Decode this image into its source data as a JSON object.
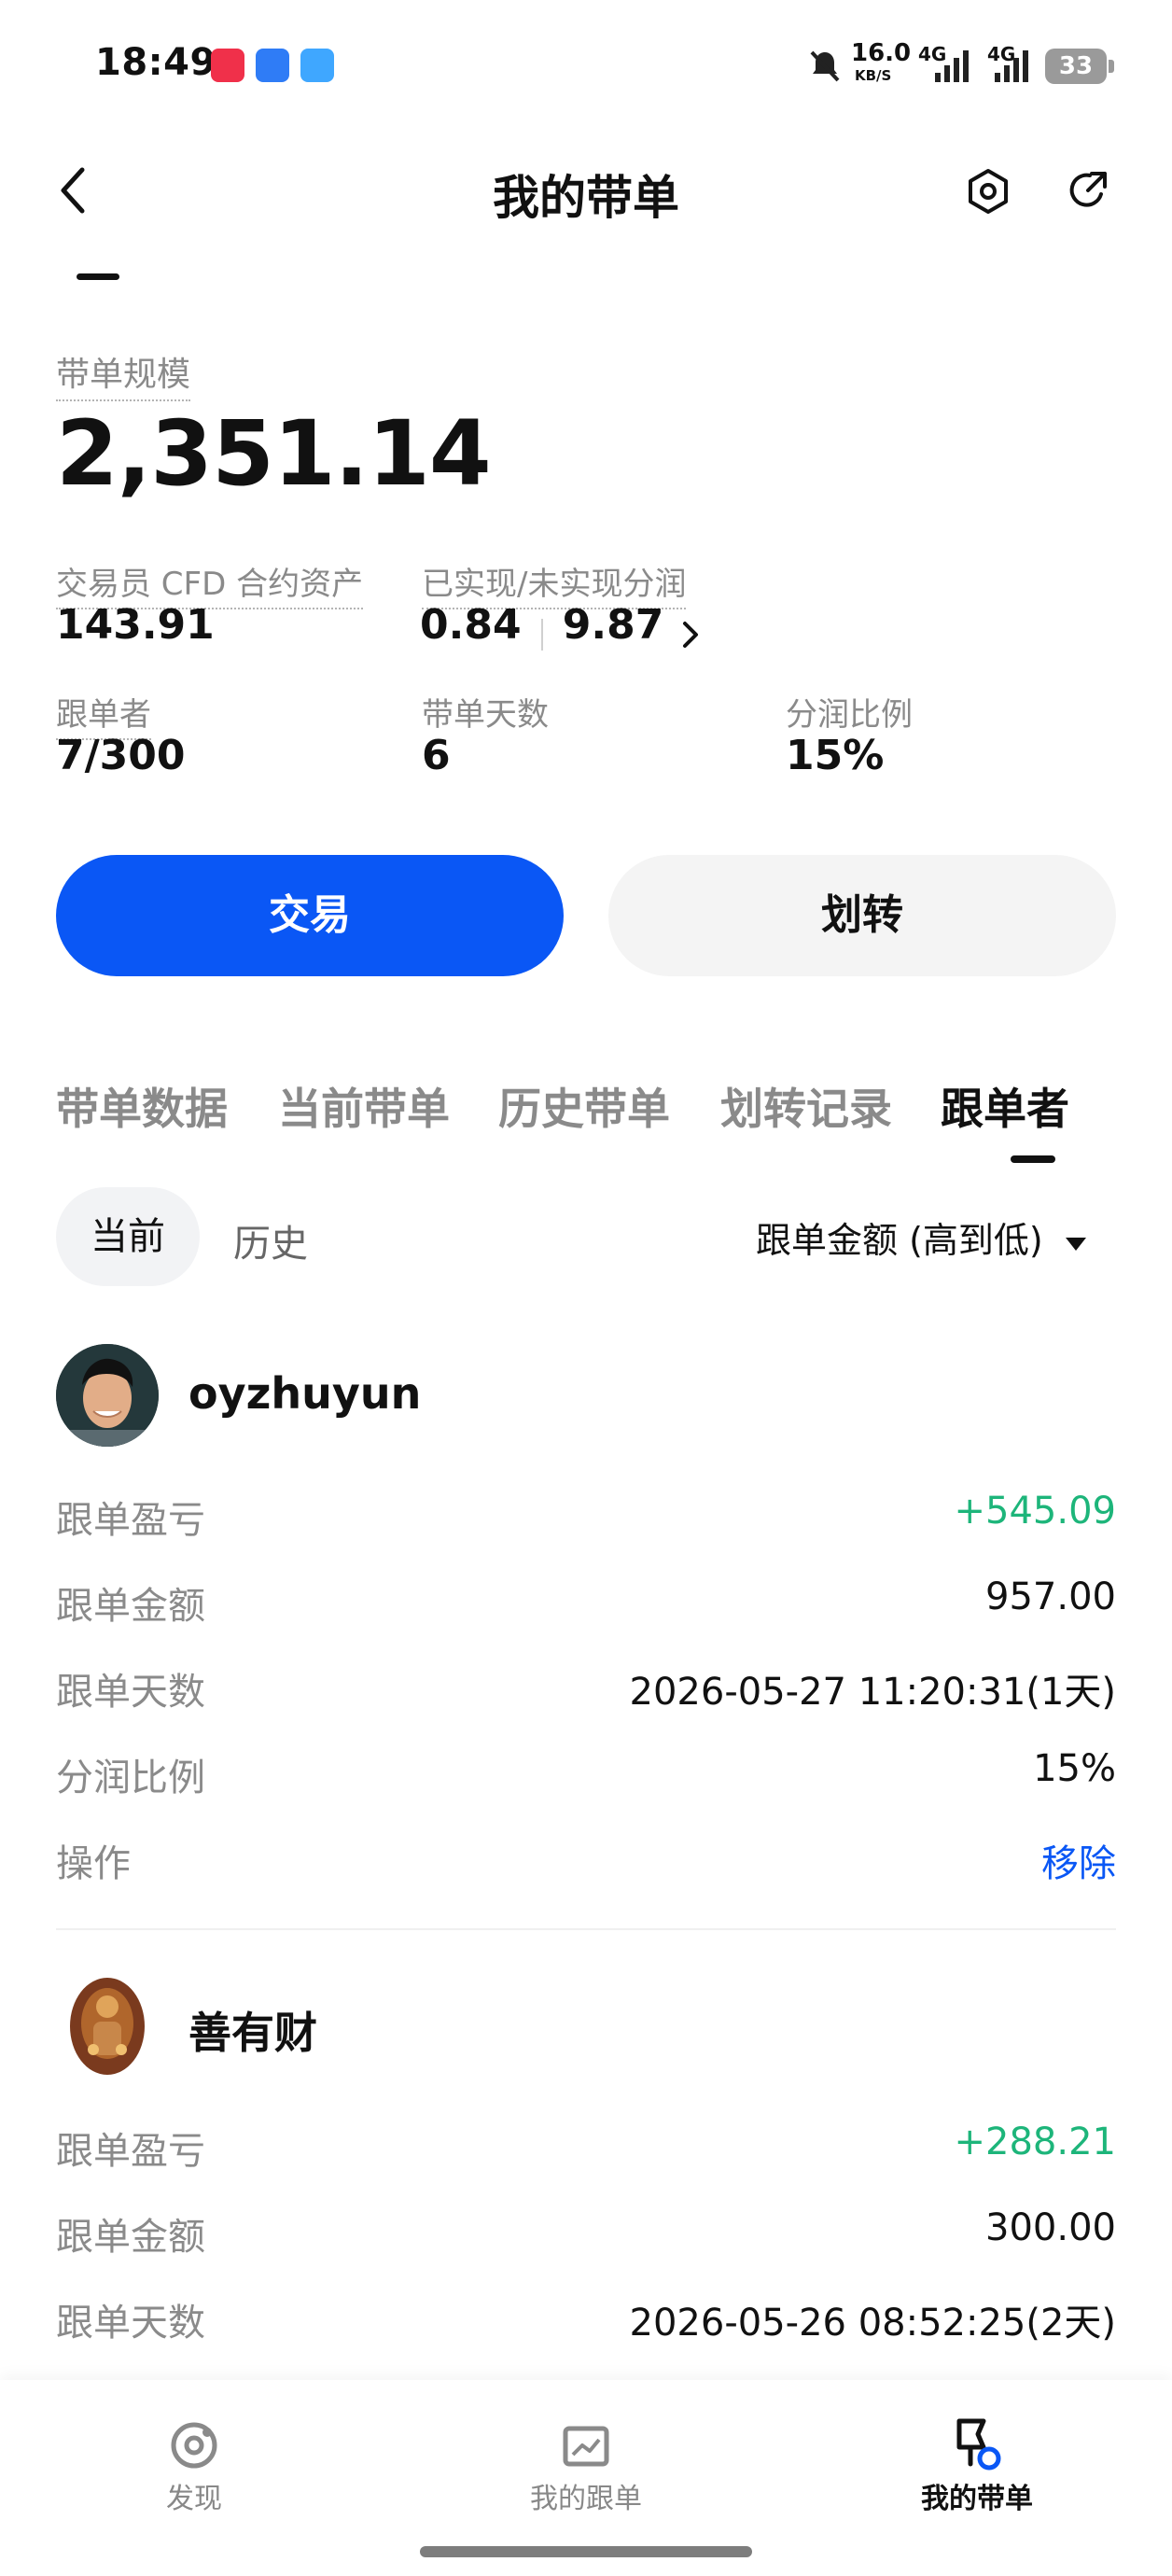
{
  "status_bar": {
    "time": "18:49",
    "net_speed_value": "16.0",
    "net_speed_unit": "KB/S",
    "net_a": "4G",
    "net_b": "4G",
    "battery": "33"
  },
  "header": {
    "title": "我的带单"
  },
  "summary": {
    "scale_label": "带单规模",
    "scale_value": "2,351.14",
    "cfd_label": "交易员 CFD 合约资产",
    "cfd_value": "143.91",
    "profit_label": "已实现/未实现分润",
    "realized": "0.84",
    "unrealized": "9.87",
    "followers_label": "跟单者",
    "followers_value": "7/300",
    "days_label": "带单天数",
    "days_value": "6",
    "share_label": "分润比例",
    "share_value": "15%"
  },
  "actions": {
    "trade": "交易",
    "transfer": "划转"
  },
  "tabs": [
    "带单数据",
    "当前带单",
    "历史带单",
    "划转记录",
    "跟单者"
  ],
  "filter": {
    "current": "当前",
    "history": "历史",
    "sort": "跟单金额 (高到低)"
  },
  "followers": [
    {
      "name": "oyzhuyun",
      "rows": [
        {
          "label": "跟单盈亏",
          "value": "+545.09"
        },
        {
          "label": "跟单金额",
          "value": "957.00"
        },
        {
          "label": "跟单天数",
          "value": "2026-05-27 11:20:31(1天)"
        },
        {
          "label": "分润比例",
          "value": "15%"
        },
        {
          "label": "操作",
          "value": "移除"
        }
      ]
    },
    {
      "name": "善有财",
      "rows": [
        {
          "label": "跟单盈亏",
          "value": "+288.21"
        },
        {
          "label": "跟单金额",
          "value": "300.00"
        },
        {
          "label": "跟单天数",
          "value": "2026-05-26 08:52:25(2天)"
        }
      ]
    }
  ],
  "nav": {
    "discover": "发现",
    "my_follow": "我的跟单",
    "my_lead": "我的带单"
  },
  "colors": {
    "accent": "#0a57f5",
    "profit": "#1db57a"
  }
}
